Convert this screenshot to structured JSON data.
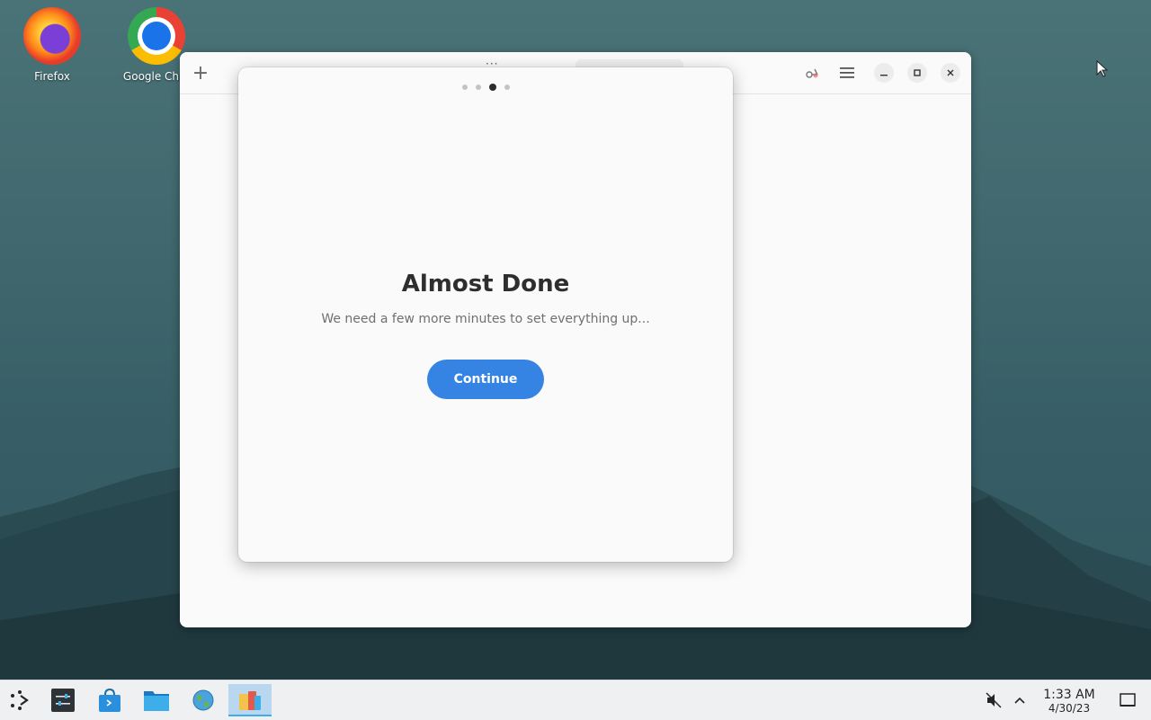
{
  "desktop": {
    "icons": [
      {
        "label": "Firefox"
      },
      {
        "label": "Google Chro"
      }
    ]
  },
  "app": {
    "header": {
      "new_tab_symbol": "+",
      "grip_symbol": "···"
    }
  },
  "dialog": {
    "title": "Almost Done",
    "subtitle": "We need a few more minutes to set everything up...",
    "continue_label": "Continue",
    "pager": {
      "total": 4,
      "current": 3
    }
  },
  "taskbar": {
    "clock_time": "1:33 AM",
    "clock_date": "4/30/23"
  },
  "colors": {
    "accent": "#3584e4",
    "taskbar_active": "#b9d7ee"
  }
}
